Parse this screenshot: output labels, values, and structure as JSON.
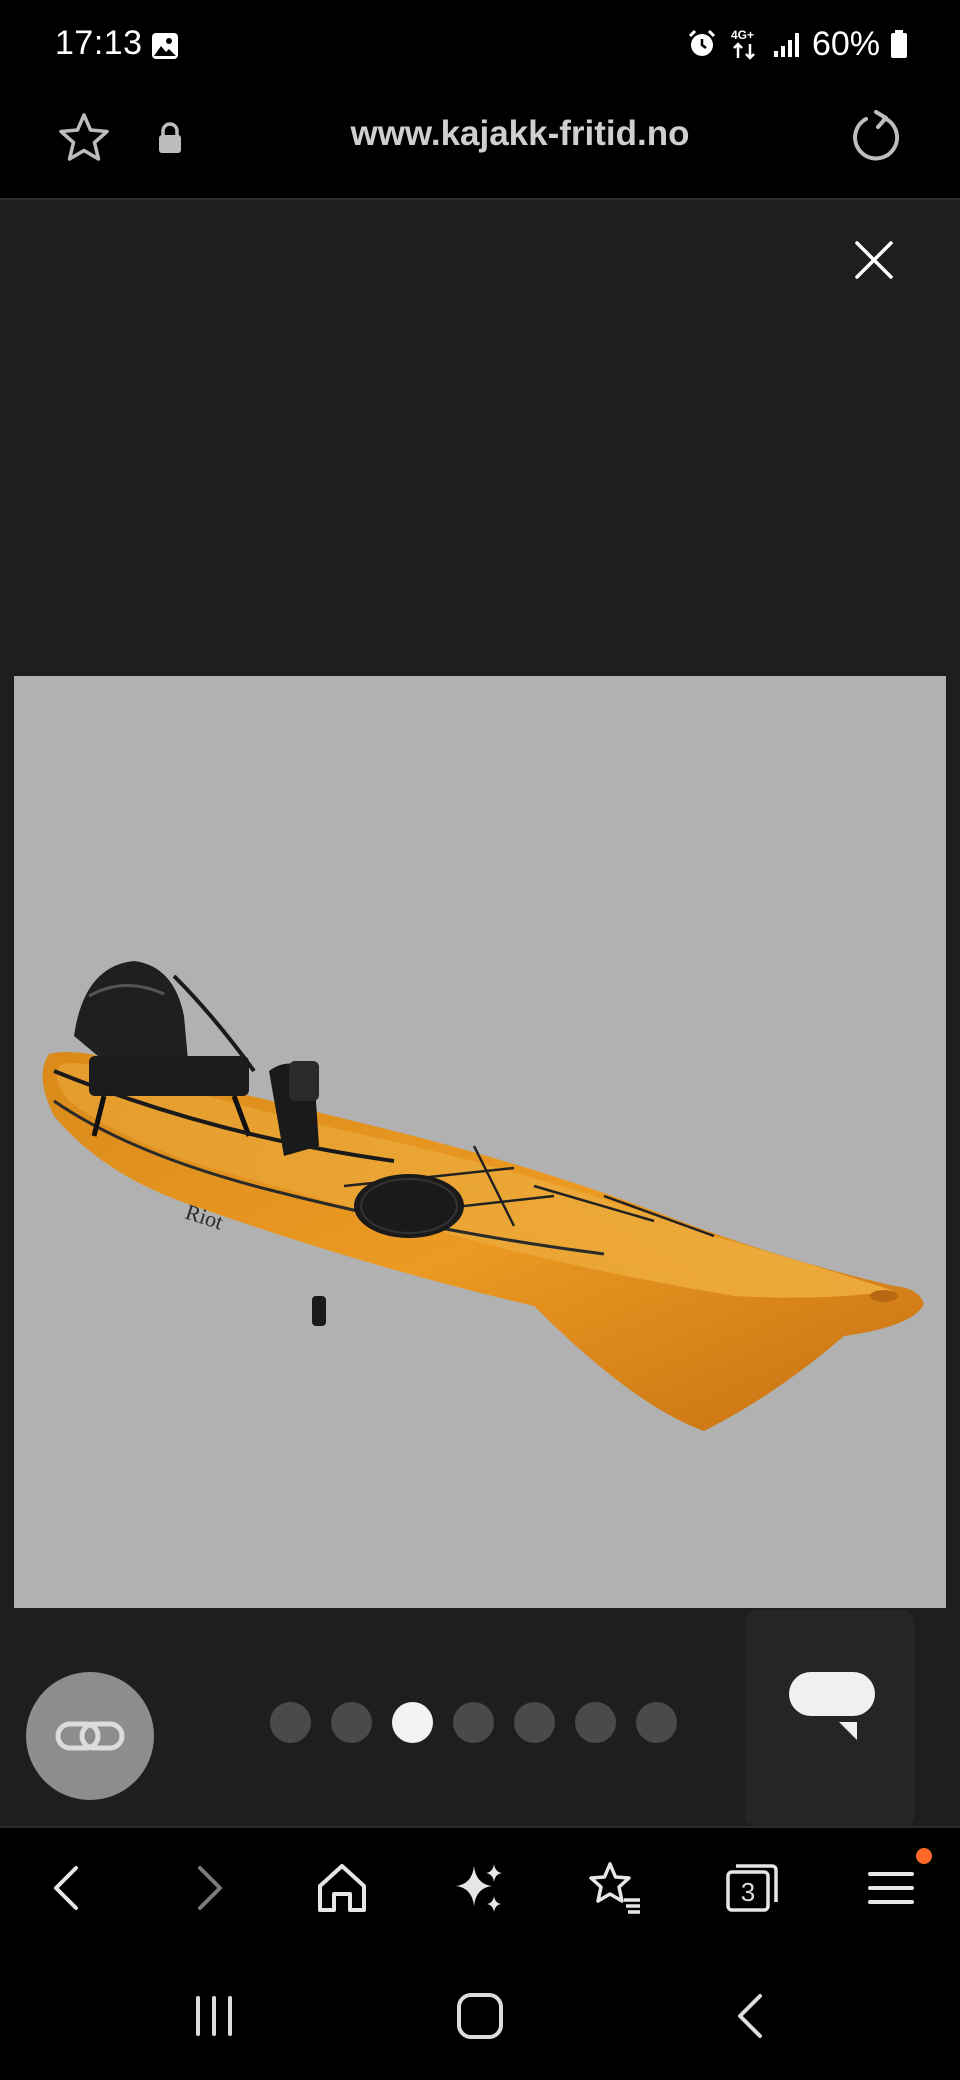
{
  "status_bar": {
    "time": "17:13",
    "battery_text": "60%",
    "network_label": "4G+",
    "icons": [
      "gallery-icon",
      "alarm-icon",
      "network-data-icon",
      "signal-icon",
      "battery-icon"
    ]
  },
  "address_bar": {
    "url": "www.kajakk-fritid.no",
    "icons": [
      "star-icon",
      "lock-icon",
      "reload-icon"
    ]
  },
  "viewer": {
    "image_subject": "kayak-photo",
    "image_background": "#b1b1b1",
    "pagination": {
      "total": 7,
      "active_index": 2
    },
    "icons": [
      "close-icon",
      "link-icon",
      "chat-icon"
    ]
  },
  "toolbar": {
    "tab_count": "3",
    "items": [
      "back-icon",
      "forward-icon",
      "home-icon",
      "sparkle-icon",
      "bookmarks-icon",
      "tabs-icon",
      "menu-icon"
    ],
    "notification_color": "#ff6a2b"
  },
  "navbar": {
    "items": [
      "recent-apps-icon",
      "home-button-icon",
      "system-back-icon"
    ]
  },
  "colors": {
    "viewer_bg": "#1e1e1e",
    "kayak_orange": "#e8901c",
    "active_dot": "#f2f2f2",
    "inactive_dot": "#4a4a4a"
  }
}
